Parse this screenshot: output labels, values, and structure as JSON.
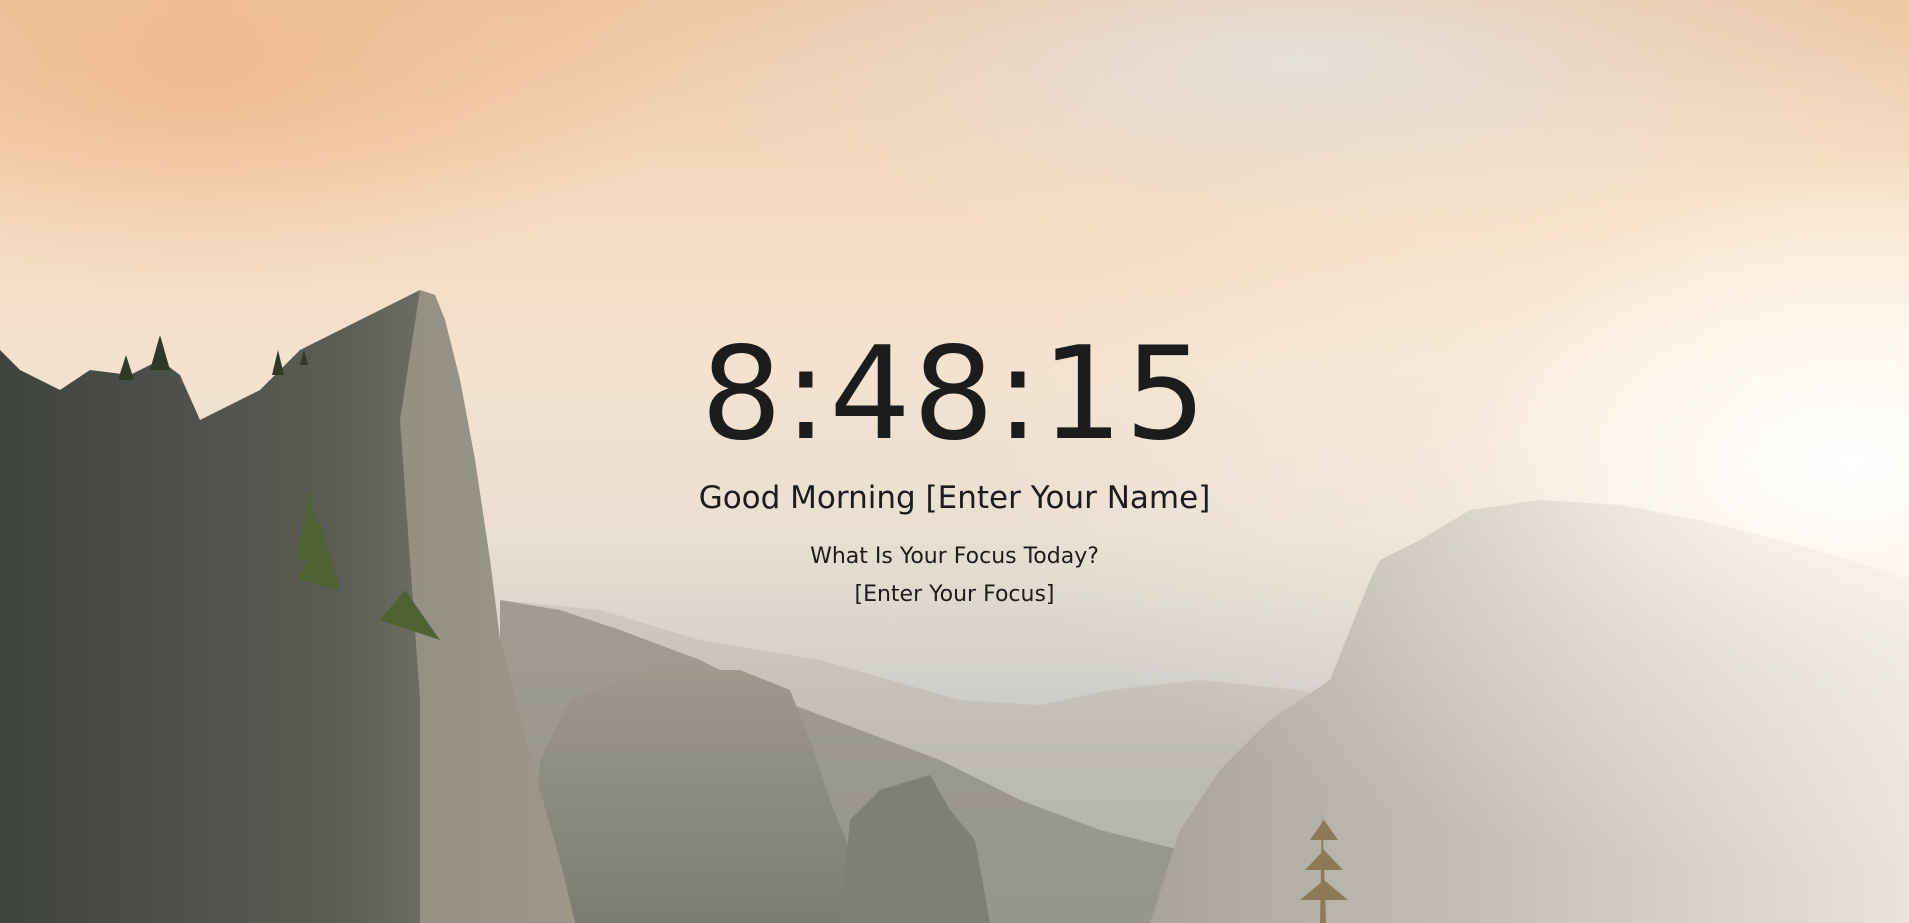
{
  "clock": {
    "time": "8:48:15"
  },
  "greeting": {
    "salutation": "Good Morning",
    "name_placeholder": "[Enter Your Name]"
  },
  "focus": {
    "question": "What Is Your Focus Today?",
    "value_placeholder": "[Enter Your Focus]"
  },
  "background": {
    "icon": "mountain-sunrise-landscape",
    "sky_color": "#f3e2cf",
    "rock_color": "#55584f",
    "text_color": "#1c1c1c"
  }
}
